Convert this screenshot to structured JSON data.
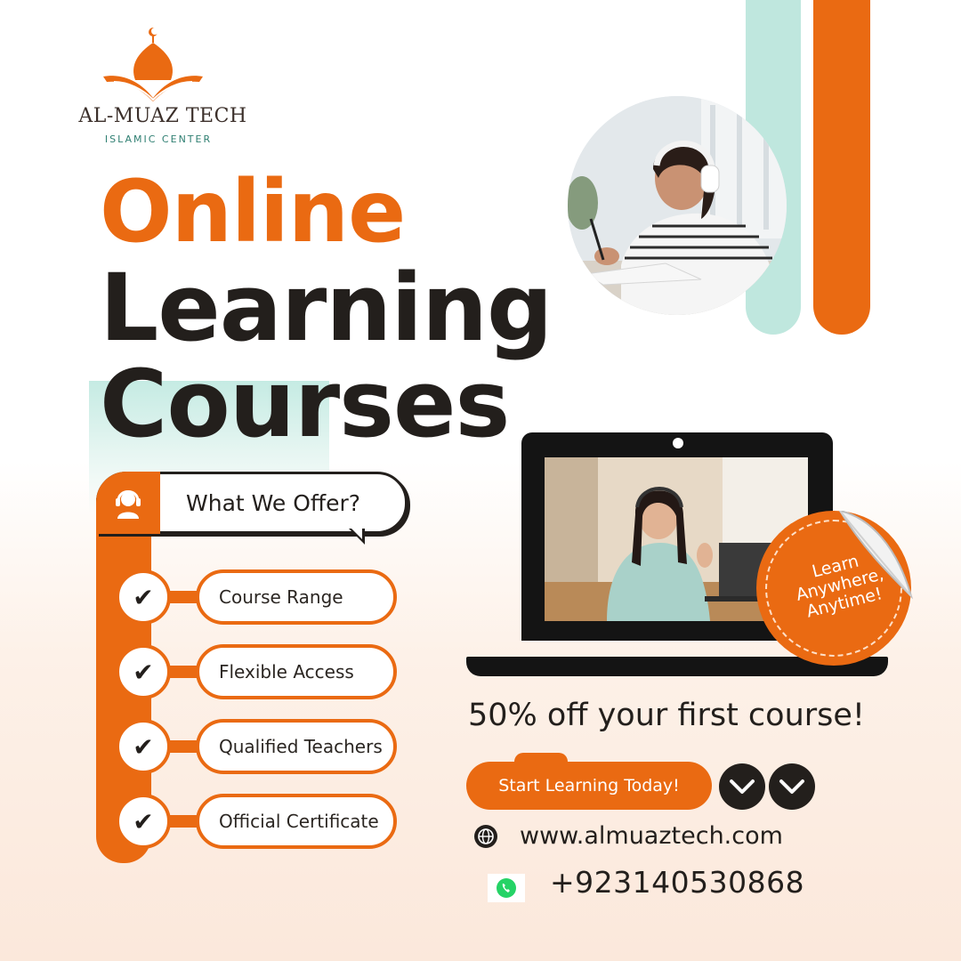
{
  "brand": {
    "name": "AL-MUAZ TECH",
    "subtitle": "ISLAMIC CENTER"
  },
  "headline": {
    "line1": "Online",
    "line2": "Learning",
    "line3": "Courses"
  },
  "offer": {
    "title": "What We Offer?",
    "icon": "support-agent-icon",
    "items": [
      {
        "check": "✔",
        "label": "Course Range"
      },
      {
        "check": "✔",
        "label": "Flexible Access"
      },
      {
        "check": "✔",
        "label": "Qualified Teachers"
      },
      {
        "check": "✔",
        "label": "Official Certificate"
      }
    ]
  },
  "sticker": {
    "text": "Learn Anywhere, Anytime!"
  },
  "promo": {
    "text": "50% off your first course!",
    "cta_label": "Start Learning Today!"
  },
  "contact": {
    "website": "www.almuaztech.com",
    "phone": "+923140530868",
    "website_icon": "globe-icon",
    "phone_icon": "whatsapp-icon"
  },
  "colors": {
    "accent": "#ea6a12",
    "dark": "#231f1c",
    "teal": "#bfe7de"
  }
}
